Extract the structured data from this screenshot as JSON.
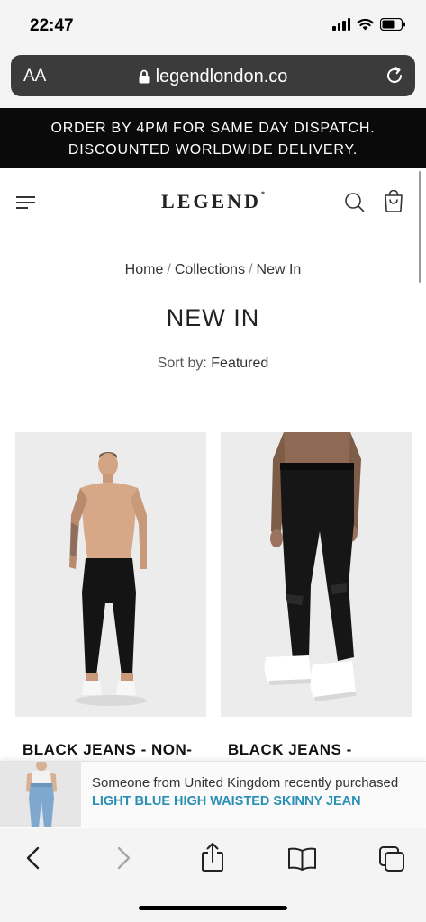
{
  "status_bar": {
    "time": "22:47"
  },
  "browser": {
    "text_size_label": "AA",
    "url": "legendlondon.co"
  },
  "announcement": {
    "line1": "ORDER BY 4PM FOR SAME DAY DISPATCH.",
    "line2": "DISCOUNTED WORLDWIDE DELIVERY."
  },
  "header": {
    "logo": "LEGEND",
    "logo_mark": "*"
  },
  "breadcrumb": {
    "items": [
      "Home",
      "Collections",
      "New In"
    ],
    "separator": "/"
  },
  "page": {
    "title": "NEW IN",
    "sort_label": "Sort by:",
    "sort_value": "Featured"
  },
  "products": [
    {
      "name": "BLACK JEANS - NON-"
    },
    {
      "name": "BLACK JEANS -"
    }
  ],
  "popup": {
    "message": "Someone from United Kingdom recently purchased",
    "product": "LIGHT BLUE HIGH WAISTED SKINNY JEAN"
  },
  "colors": {
    "announcement_bg": "#0a0a0a",
    "address_bar_bg": "#3b3b3b",
    "popup_link": "#2a8fb5",
    "disabled_icon": "#a6a6a6"
  },
  "icons": {
    "status": [
      "signal-icon",
      "wifi-icon",
      "battery-icon"
    ],
    "header": [
      "menu-icon",
      "search-icon",
      "shopping-bag-icon"
    ],
    "toolbar": [
      "back-icon",
      "forward-icon",
      "share-icon",
      "bookmarks-icon",
      "tabs-icon"
    ]
  }
}
